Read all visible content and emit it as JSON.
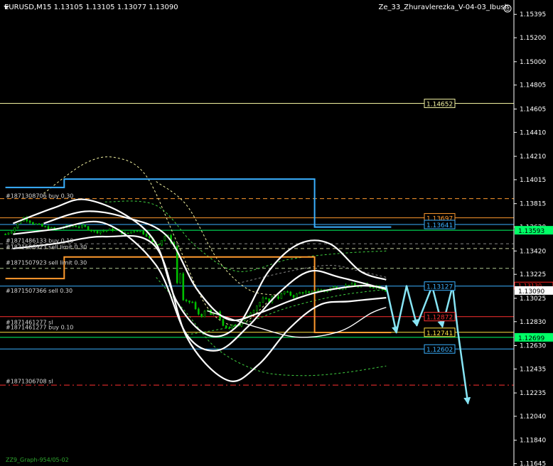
{
  "header": {
    "symbol_info": "EURUSD,M15  1.13105 1.13105 1.13077 1.13090",
    "indicator": "Ze_33_Zhuravlerezka_V-04-03_Ibush"
  },
  "footer": {
    "text": "ZZ9_Graph-954/05-02"
  },
  "colors": {
    "background": "#000000",
    "axis": "#ffffff",
    "candles": "#00c000",
    "bands": "#ffffff",
    "zigzag": "#87e5f5",
    "current_price": "#00ff66"
  },
  "chart_data": {
    "type": "candlestick",
    "title": "EURUSD,M15",
    "ohlc": {
      "open": 1.13105,
      "high": 1.13105,
      "low": 1.13077,
      "close": 1.1309
    },
    "y_ticks": [
      "1.15395",
      "1.15200",
      "1.15000",
      "1.14805",
      "1.14605",
      "1.14410",
      "1.14210",
      "1.14015",
      "1.13815",
      "1.13620",
      "1.13420",
      "1.13225",
      "1.13025",
      "1.12830",
      "1.12630",
      "1.12435",
      "1.12235",
      "1.12040",
      "1.11840",
      "1.11645"
    ],
    "ylim": [
      1.11625,
      1.15515
    ],
    "price_tags": [
      {
        "label": "1.13593",
        "price": 1.13593,
        "color": "#00ff66",
        "text_color": "#000000"
      },
      {
        "label": "1.13090",
        "price": 1.1309,
        "color": "#ffffff",
        "text_color": "#000000"
      },
      {
        "label": "1.12699",
        "price": 1.12699,
        "color": "#00ff66",
        "text_color": "#000000"
      }
    ],
    "price_tags_small": [
      {
        "label": "1.13130",
        "price": 1.1313,
        "color": "#ff2020",
        "text_color": "#ff2020"
      }
    ],
    "levels": [
      {
        "price": 1.14652,
        "color": "#f0f0a0",
        "dash": "",
        "label": "1.14652",
        "label_color": "#f0f0a0"
      },
      {
        "price": 1.13857,
        "color": "#ff9a2e",
        "dash": "6,4",
        "label": "",
        "label_color": ""
      },
      {
        "price": 1.13697,
        "color": "#ff9a2e",
        "dash": "",
        "label": "1.13697",
        "label_color": "#ff9a2e"
      },
      {
        "price": 1.13641,
        "color": "#3ab0ff",
        "dash": "",
        "label": "1.13641",
        "label_color": "#3ab0ff"
      },
      {
        "price": 1.13593,
        "color": "#00ff66",
        "dash": "",
        "label": "",
        "label_color": ""
      },
      {
        "price": 1.1348,
        "color": "#888888",
        "dash": "4,4",
        "label": "",
        "label_color": ""
      },
      {
        "price": 1.1344,
        "color": "#c8d0a0",
        "dash": "5,4",
        "label": "",
        "label_color": ""
      },
      {
        "price": 1.13275,
        "color": "#b0c890",
        "dash": "5,4",
        "label": "",
        "label_color": ""
      },
      {
        "price": 1.13127,
        "color": "#3ab0ff",
        "dash": "",
        "label": "1.13127",
        "label_color": "#3ab0ff"
      },
      {
        "price": 1.12872,
        "color": "#ff3030",
        "dash": "",
        "label": "1.12872",
        "label_color": "#ff3030"
      },
      {
        "price": 1.12741,
        "color": "#ffe040",
        "dash": "",
        "label": "1.12741",
        "label_color": "#ffe040"
      },
      {
        "price": 1.12699,
        "color": "#00ff66",
        "dash": "",
        "label": "",
        "label_color": ""
      },
      {
        "price": 1.12602,
        "color": "#3ab0ff",
        "dash": "",
        "label": "1.12602",
        "label_color": "#3ab0ff"
      },
      {
        "price": 1.123,
        "color": "#ff3030",
        "dash": "8,4,2,4",
        "label": "",
        "label_color": ""
      }
    ],
    "order_labels": [
      {
        "text": "#1871308706 buy 0.30",
        "price": 1.1388
      },
      {
        "text": "#1871486133 buy 0.10",
        "price": 1.13508
      },
      {
        "text": "#1871508923 sell limit 0.30",
        "price": 1.13455
      },
      {
        "text": "#1871507923 sell limit 0.30",
        "price": 1.13325
      },
      {
        "text": "#1871507366 sell 0.30",
        "price": 1.1309
      },
      {
        "text": "#1871461277 sl",
        "price": 1.12825
      },
      {
        "text": "#1871461277 buy 0.10",
        "price": 1.12785
      },
      {
        "text": "#1871306708 sl",
        "price": 1.12335
      }
    ],
    "channels": [
      {
        "color": "#3ab0ff",
        "points": [
          [
            0.5,
            1.1395
          ],
          [
            12,
            1.1395
          ],
          [
            12,
            1.1402
          ],
          [
            61,
            1.1402
          ],
          [
            61,
            1.1362
          ],
          [
            76,
            1.1362
          ]
        ]
      },
      {
        "color": "#ff9a2e",
        "points": [
          [
            0.5,
            1.1319
          ],
          [
            12,
            1.1319
          ],
          [
            12,
            1.1337
          ],
          [
            61,
            1.1337
          ],
          [
            61,
            1.1274
          ],
          [
            76,
            1.1274
          ]
        ]
      }
    ],
    "bands": [
      {
        "width": 2.2,
        "points": [
          [
            2,
            1.1365
          ],
          [
            10,
            1.1378
          ],
          [
            16,
            1.1385
          ],
          [
            24,
            1.1372
          ],
          [
            30,
            1.1348
          ],
          [
            34,
            1.13
          ],
          [
            40,
            1.1272
          ],
          [
            46,
            1.128
          ],
          [
            52,
            1.1325
          ],
          [
            58,
            1.1348
          ],
          [
            64,
            1.1348
          ],
          [
            70,
            1.1325
          ],
          [
            75,
            1.1318
          ]
        ]
      },
      {
        "width": 2.2,
        "points": [
          [
            2,
            1.1356
          ],
          [
            10,
            1.136
          ],
          [
            20,
            1.1365
          ],
          [
            30,
            1.133
          ],
          [
            36,
            1.1272
          ],
          [
            42,
            1.1259
          ],
          [
            48,
            1.1279
          ],
          [
            54,
            1.1307
          ],
          [
            60,
            1.1325
          ],
          [
            66,
            1.132
          ],
          [
            75,
            1.131
          ]
        ]
      },
      {
        "width": 2.2,
        "points": [
          [
            2,
            1.1344
          ],
          [
            10,
            1.1348
          ],
          [
            20,
            1.1354
          ],
          [
            30,
            1.1345
          ],
          [
            36,
            1.127
          ],
          [
            44,
            1.1234
          ],
          [
            50,
            1.1247
          ],
          [
            56,
            1.1277
          ],
          [
            62,
            1.1297
          ],
          [
            68,
            1.13
          ],
          [
            75,
            1.1303
          ]
        ]
      },
      {
        "width": 2.2,
        "points": [
          [
            8,
            1.1365
          ],
          [
            16,
            1.1375
          ],
          [
            24,
            1.137
          ],
          [
            32,
            1.1355
          ],
          [
            38,
            1.131
          ],
          [
            44,
            1.1285
          ],
          [
            50,
            1.129
          ],
          [
            56,
            1.13
          ],
          [
            62,
            1.1308
          ],
          [
            70,
            1.1313
          ],
          [
            75,
            1.1311
          ]
        ]
      },
      {
        "width": 1.4,
        "points": [
          [
            40,
            1.1292
          ],
          [
            50,
            1.1278
          ],
          [
            58,
            1.127
          ],
          [
            66,
            1.1275
          ],
          [
            72,
            1.129
          ],
          [
            75,
            1.1295
          ]
        ]
      }
    ],
    "dashed_curves": [
      {
        "color": "#f0f0a0",
        "width": 1,
        "points": [
          [
            8,
            1.139
          ],
          [
            16,
            1.1415
          ],
          [
            22,
            1.142
          ],
          [
            28,
            1.1405
          ],
          [
            34,
            1.135
          ],
          [
            40,
            1.1295
          ],
          [
            46,
            1.128
          ],
          [
            52,
            1.13
          ]
        ]
      },
      {
        "color": "#f0f0a0",
        "width": 1,
        "points": [
          [
            30,
            1.14
          ],
          [
            36,
            1.138
          ],
          [
            42,
            1.1335
          ],
          [
            48,
            1.131
          ],
          [
            54,
            1.1305
          ]
        ]
      },
      {
        "color": "#40d040",
        "width": 1,
        "points": [
          [
            20,
            1.1383
          ],
          [
            30,
            1.138
          ],
          [
            38,
            1.1345
          ],
          [
            46,
            1.1325
          ],
          [
            56,
            1.1335
          ],
          [
            66,
            1.134
          ],
          [
            75,
            1.1342
          ]
        ]
      },
      {
        "color": "#40d040",
        "width": 1,
        "points": [
          [
            30,
            1.132
          ],
          [
            36,
            1.129
          ],
          [
            42,
            1.126
          ],
          [
            50,
            1.1242
          ],
          [
            58,
            1.1238
          ],
          [
            66,
            1.124
          ],
          [
            75,
            1.1246
          ]
        ]
      },
      {
        "color": "#40d040",
        "width": 1,
        "points": [
          [
            36,
            1.1272
          ],
          [
            46,
            1.128
          ],
          [
            56,
            1.1295
          ],
          [
            66,
            1.1305
          ],
          [
            75,
            1.131
          ]
        ]
      },
      {
        "color": "#888888",
        "width": 1,
        "points": [
          [
            46,
            1.1315
          ],
          [
            56,
            1.1325
          ],
          [
            64,
            1.133
          ],
          [
            70,
            1.1325
          ],
          [
            75,
            1.132
          ]
        ]
      }
    ],
    "zigzag": {
      "width": 2.5,
      "points": [
        [
          75,
          1.13127
        ],
        [
          77,
          1.12741
        ],
        [
          79,
          1.13127
        ],
        [
          81,
          1.128
        ],
        [
          84,
          1.13127
        ],
        [
          86,
          1.1279
        ],
        [
          88,
          1.13127
        ],
        [
          89,
          1.1276
        ],
        [
          91,
          1.1215
        ]
      ]
    },
    "zigzag_arrow_ends": [
      1,
      3,
      5,
      8
    ],
    "candle_path": [
      [
        0.5,
        1.1356
      ],
      [
        2,
        1.136
      ],
      [
        4,
        1.137
      ],
      [
        6,
        1.1365
      ],
      [
        8,
        1.1362
      ],
      [
        10,
        1.136
      ],
      [
        12,
        1.1362
      ],
      [
        14,
        1.1363
      ],
      [
        16,
        1.1362
      ],
      [
        18,
        1.1358
      ],
      [
        20,
        1.1359
      ],
      [
        22,
        1.136
      ],
      [
        24,
        1.1356
      ],
      [
        26,
        1.136
      ],
      [
        28,
        1.1356
      ],
      [
        29.5,
        1.1348
      ],
      [
        30.5,
        1.1348
      ],
      [
        32,
        1.1356
      ],
      [
        33.5,
        1.1346
      ],
      [
        34,
        1.131
      ],
      [
        34.5,
        1.1338
      ],
      [
        35,
        1.1301
      ],
      [
        36,
        1.1299
      ],
      [
        37,
        1.13
      ],
      [
        38,
        1.129
      ],
      [
        39,
        1.1288
      ],
      [
        40,
        1.1293
      ],
      [
        41,
        1.1287
      ],
      [
        42,
        1.1292
      ],
      [
        43,
        1.1279
      ],
      [
        44,
        1.1276
      ],
      [
        45,
        1.1282
      ],
      [
        46,
        1.1279
      ],
      [
        47,
        1.1285
      ],
      [
        48,
        1.1289
      ],
      [
        49,
        1.1293
      ],
      [
        50,
        1.1298
      ],
      [
        51,
        1.1302
      ],
      [
        52,
        1.13
      ],
      [
        53,
        1.1305
      ],
      [
        54,
        1.1303
      ],
      [
        55,
        1.1308
      ],
      [
        56,
        1.1306
      ],
      [
        57,
        1.1304
      ],
      [
        58,
        1.1307
      ],
      [
        59,
        1.1308
      ],
      [
        60,
        1.1306
      ],
      [
        61,
        1.1309
      ],
      [
        62,
        1.131
      ],
      [
        63,
        1.1308
      ],
      [
        64,
        1.1311
      ],
      [
        65,
        1.1312
      ],
      [
        66,
        1.1311
      ],
      [
        67,
        1.1313
      ],
      [
        68,
        1.1314
      ],
      [
        69,
        1.1312
      ],
      [
        70,
        1.1313
      ],
      [
        71,
        1.1314
      ],
      [
        72,
        1.1312
      ],
      [
        73,
        1.1313
      ],
      [
        74,
        1.1311
      ],
      [
        75,
        1.1309
      ]
    ],
    "grid": false,
    "legend": "none"
  }
}
